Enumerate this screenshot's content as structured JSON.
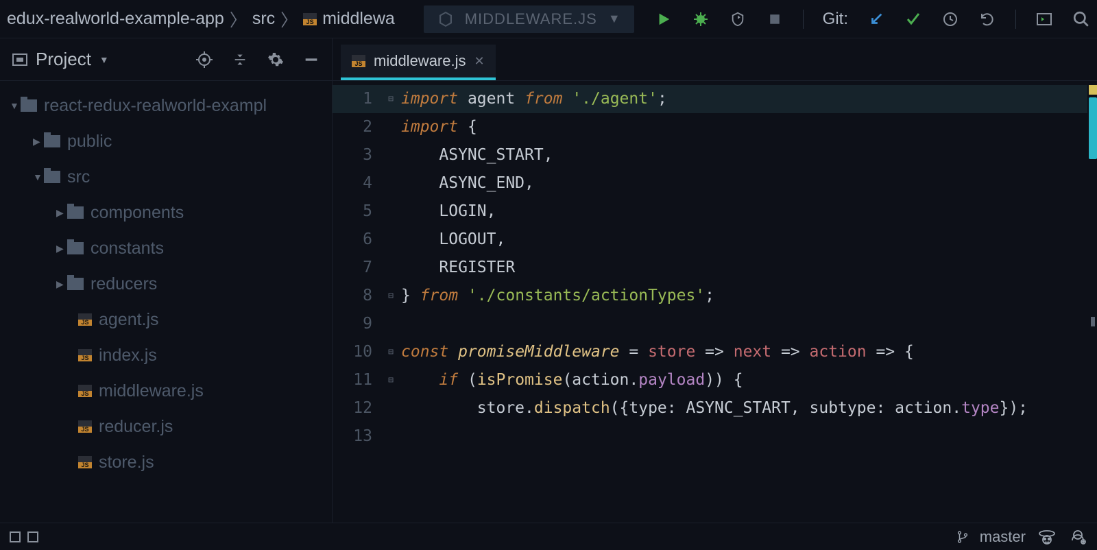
{
  "breadcrumb": {
    "seg0": "edux-realworld-example-app",
    "seg1": "src",
    "seg2": "middlewa"
  },
  "runconfig": {
    "label": "MIDDLEWARE.JS"
  },
  "git": {
    "label": "Git:"
  },
  "sidebar": {
    "title": "Project",
    "root": "react-redux-realworld-exampl",
    "folders": [
      {
        "name": "public",
        "expanded": false
      },
      {
        "name": "src",
        "expanded": true,
        "children": [
          {
            "name": "components",
            "type": "folder"
          },
          {
            "name": "constants",
            "type": "folder"
          },
          {
            "name": "reducers",
            "type": "folder"
          },
          {
            "name": "agent.js",
            "type": "js"
          },
          {
            "name": "index.js",
            "type": "js"
          },
          {
            "name": "middleware.js",
            "type": "js"
          },
          {
            "name": "reducer.js",
            "type": "js"
          },
          {
            "name": "store.js",
            "type": "js"
          }
        ]
      }
    ]
  },
  "tab": {
    "label": "middleware.js"
  },
  "code": {
    "lines": [
      1,
      2,
      3,
      4,
      5,
      6,
      7,
      8,
      9,
      10,
      11,
      12,
      13
    ],
    "content": [
      [
        {
          "c": "kw",
          "t": "import"
        },
        {
          "c": "sp",
          "t": " "
        },
        {
          "c": "id",
          "t": "agent"
        },
        {
          "c": "sp",
          "t": " "
        },
        {
          "c": "kw",
          "t": "from"
        },
        {
          "c": "sp",
          "t": " "
        },
        {
          "c": "str",
          "t": "'./agent'"
        },
        {
          "c": "pun",
          "t": ";"
        }
      ],
      [
        {
          "c": "kw",
          "t": "import"
        },
        {
          "c": "sp",
          "t": " "
        },
        {
          "c": "pun",
          "t": "{"
        }
      ],
      [
        {
          "c": "indent",
          "t": "    "
        },
        {
          "c": "id",
          "t": "ASYNC_START"
        },
        {
          "c": "pun",
          "t": ","
        }
      ],
      [
        {
          "c": "indent",
          "t": "    "
        },
        {
          "c": "id",
          "t": "ASYNC_END"
        },
        {
          "c": "pun",
          "t": ","
        }
      ],
      [
        {
          "c": "indent",
          "t": "    "
        },
        {
          "c": "id",
          "t": "LOGIN"
        },
        {
          "c": "pun",
          "t": ","
        }
      ],
      [
        {
          "c": "indent",
          "t": "    "
        },
        {
          "c": "id",
          "t": "LOGOUT"
        },
        {
          "c": "pun",
          "t": ","
        }
      ],
      [
        {
          "c": "indent",
          "t": "    "
        },
        {
          "c": "id",
          "t": "REGISTER"
        }
      ],
      [
        {
          "c": "pun",
          "t": "} "
        },
        {
          "c": "kw",
          "t": "from"
        },
        {
          "c": "sp",
          "t": " "
        },
        {
          "c": "str",
          "t": "'./constants/actionTypes'"
        },
        {
          "c": "pun",
          "t": ";"
        }
      ],
      [],
      [
        {
          "c": "kw",
          "t": "const"
        },
        {
          "c": "sp",
          "t": " "
        },
        {
          "c": "fn",
          "t": "promiseMiddleware"
        },
        {
          "c": "sp",
          "t": " "
        },
        {
          "c": "op",
          "t": "= "
        },
        {
          "c": "arg",
          "t": "store"
        },
        {
          "c": "op",
          "t": " => "
        },
        {
          "c": "arg",
          "t": "next"
        },
        {
          "c": "op",
          "t": " => "
        },
        {
          "c": "arg",
          "t": "action"
        },
        {
          "c": "op",
          "t": " => "
        },
        {
          "c": "pun",
          "t": "{"
        }
      ],
      [
        {
          "c": "indent",
          "t": "    "
        },
        {
          "c": "kw",
          "t": "if"
        },
        {
          "c": "sp",
          "t": " "
        },
        {
          "c": "pun",
          "t": "("
        },
        {
          "c": "fn2",
          "t": "isPromise"
        },
        {
          "c": "pun",
          "t": "("
        },
        {
          "c": "id",
          "t": "action"
        },
        {
          "c": "pun",
          "t": "."
        },
        {
          "c": "prop",
          "t": "payload"
        },
        {
          "c": "pun",
          "t": ")) {"
        }
      ],
      [
        {
          "c": "indent",
          "t": "        "
        },
        {
          "c": "id",
          "t": "store"
        },
        {
          "c": "pun",
          "t": "."
        },
        {
          "c": "fn2",
          "t": "dispatch"
        },
        {
          "c": "pun",
          "t": "({"
        },
        {
          "c": "id",
          "t": "type"
        },
        {
          "c": "pun",
          "t": ": "
        },
        {
          "c": "id",
          "t": "ASYNC_START"
        },
        {
          "c": "pun",
          "t": ", "
        },
        {
          "c": "id",
          "t": "subtype"
        },
        {
          "c": "pun",
          "t": ": "
        },
        {
          "c": "id",
          "t": "action"
        },
        {
          "c": "pun",
          "t": "."
        },
        {
          "c": "prop",
          "t": "type"
        },
        {
          "c": "pun",
          "t": "});"
        }
      ],
      []
    ]
  },
  "status": {
    "branch": "master"
  }
}
